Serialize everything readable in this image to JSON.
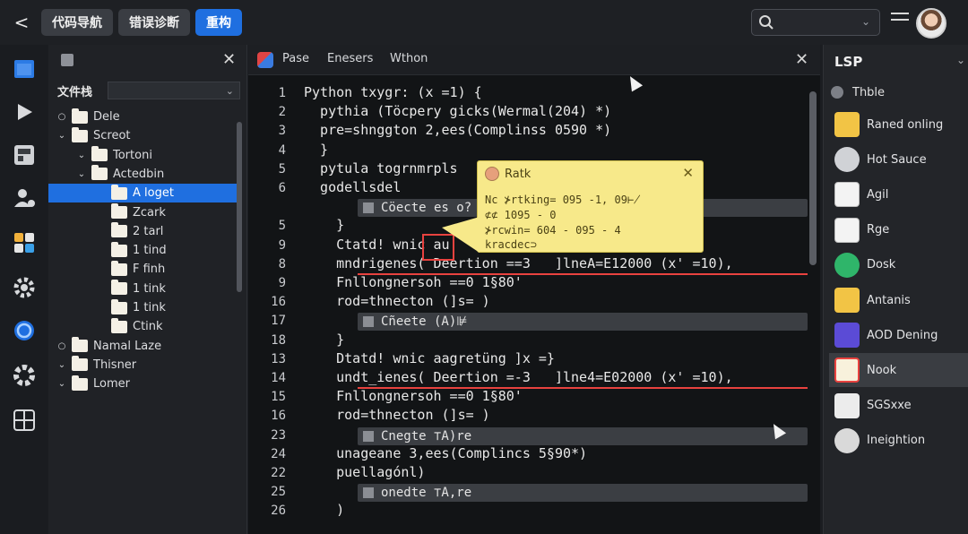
{
  "topbar": {
    "back": "<",
    "tabs": [
      {
        "label": "代码导航",
        "active": false
      },
      {
        "label": "错误诊断",
        "active": false
      },
      {
        "label": "重构",
        "active": true
      }
    ]
  },
  "activity": {
    "icons": [
      "files-icon",
      "run-icon",
      "extensions-icon",
      "account-icon",
      "apps-icon",
      "settings-icon",
      "sync-icon",
      "gear-icon",
      "grid-icon"
    ]
  },
  "explorer": {
    "label": "文件栈",
    "tree": [
      {
        "name": "Dele",
        "depth": 0,
        "twisty": "○",
        "selected": false
      },
      {
        "name": "Screot",
        "depth": 0,
        "twisty": "⌄",
        "selected": false
      },
      {
        "name": "Tortoni",
        "depth": 1,
        "twisty": "⌄",
        "selected": false
      },
      {
        "name": "Actedbin",
        "depth": 1,
        "twisty": "⌄",
        "selected": false
      },
      {
        "name": "A loget",
        "depth": 2,
        "twisty": "",
        "selected": true
      },
      {
        "name": "Zcark",
        "depth": 2,
        "twisty": "",
        "selected": false
      },
      {
        "name": "2 tarl",
        "depth": 2,
        "twisty": "",
        "selected": false
      },
      {
        "name": "1 tind",
        "depth": 2,
        "twisty": "",
        "selected": false
      },
      {
        "name": "F finh",
        "depth": 2,
        "twisty": "",
        "selected": false
      },
      {
        "name": "1 tink",
        "depth": 2,
        "twisty": "",
        "selected": false
      },
      {
        "name": "1 tink",
        "depth": 2,
        "twisty": "",
        "selected": false
      },
      {
        "name": "Ctink",
        "depth": 2,
        "twisty": "",
        "selected": false
      },
      {
        "name": "Namal Laze",
        "depth": 0,
        "twisty": "○",
        "selected": false
      },
      {
        "name": "Thisner",
        "depth": 0,
        "twisty": "⌄",
        "selected": false
      },
      {
        "name": "Lomer",
        "depth": 0,
        "twisty": "⌄",
        "selected": false
      }
    ]
  },
  "editor": {
    "tabs": [
      "Pase",
      "Enesers",
      "Wthon"
    ],
    "lines": [
      {
        "num": "1",
        "text": "Python txygr: (x =1) {"
      },
      {
        "num": "2",
        "text": "  pythia (Töcpery gicks(Wermal(204) *)"
      },
      {
        "num": "3",
        "text": "  pre=shnggton 2,ees(Complinss 0590 *)"
      },
      {
        "num": "4",
        "text": "  }"
      },
      {
        "num": "5",
        "text": "  pytula togrnmrpls"
      },
      {
        "num": "6",
        "text": "  godellsdel"
      },
      {
        "num": "",
        "text": ""
      },
      {
        "num": "5",
        "text": "    }"
      },
      {
        "num": "9",
        "text": "    Ctatd! wnic au"
      },
      {
        "num": "8",
        "text": "    mndrigenes( Deertion ==3   ]lneA=E12000 (x' =10),"
      },
      {
        "num": "9",
        "text": "    Fnllongnersoh ==0 1§80'"
      },
      {
        "num": "16",
        "text": "    rod=thnecton (]s= )"
      },
      {
        "num": "17",
        "text": ""
      },
      {
        "num": "18",
        "text": "    }"
      },
      {
        "num": "13",
        "text": "    Dtatd! wnic aagretüng ]x =}"
      },
      {
        "num": "14",
        "text": "    undt_ienes( Deertion =-3   ]lne4=E02000 (x' =10),"
      },
      {
        "num": "15",
        "text": "    Fnllongnersoh ==0 1§80'"
      },
      {
        "num": "16",
        "text": "    rod=thnecton (]s= )"
      },
      {
        "num": "23",
        "text": ""
      },
      {
        "num": "24",
        "text": "    unageane 3,ees(Complincs 5§90*)"
      },
      {
        "num": "22",
        "text": "    puellagónl)"
      },
      {
        "num": "25",
        "text": ""
      },
      {
        "num": "26",
        "text": "    )"
      }
    ],
    "folds": [
      {
        "label": "Cöecte es o?",
        "line": 6
      },
      {
        "label": "Cñeete (A)⊯",
        "line": 12
      },
      {
        "label": "Cnegte ⊤A)re",
        "line": 18
      },
      {
        "label": "onedte ⊤A,re",
        "line": 21
      }
    ]
  },
  "tooltip": {
    "title": "Ratk",
    "lines": [
      "Nc ⊁rtking= 095 -1, 09⊬",
      "   ⊄⊄ 1095 - 0",
      "   ⊁rcwin= 604 - 095 - 4",
      "   kracdec⊃"
    ]
  },
  "rpanel": {
    "title": "LSP",
    "subtitle": "Thble",
    "items": [
      {
        "label": "Raned onling",
        "icon": "folder-yellow-icon",
        "selected": false
      },
      {
        "label": "Hot Sauce",
        "icon": "paw-icon",
        "selected": false
      },
      {
        "label": "Agil",
        "icon": "document-icon",
        "selected": false
      },
      {
        "label": "Rge",
        "icon": "document-icon",
        "selected": false
      },
      {
        "label": "Dosk",
        "icon": "check-icon",
        "selected": false
      },
      {
        "label": "Antanis",
        "icon": "folder-yellow-icon",
        "selected": false
      },
      {
        "label": "AOD Dening",
        "icon": "grid-icon",
        "selected": false
      },
      {
        "label": "Nook",
        "icon": "folder-icon",
        "selected": true
      },
      {
        "label": "SGSxxe",
        "icon": "letter-e-icon",
        "selected": false
      },
      {
        "label": "Ineightion",
        "icon": "close-circle-icon",
        "selected": false
      }
    ]
  },
  "colors": {
    "accent": "#1f6fe0",
    "error": "#e8423f",
    "tooltip": "#f7e98a"
  }
}
